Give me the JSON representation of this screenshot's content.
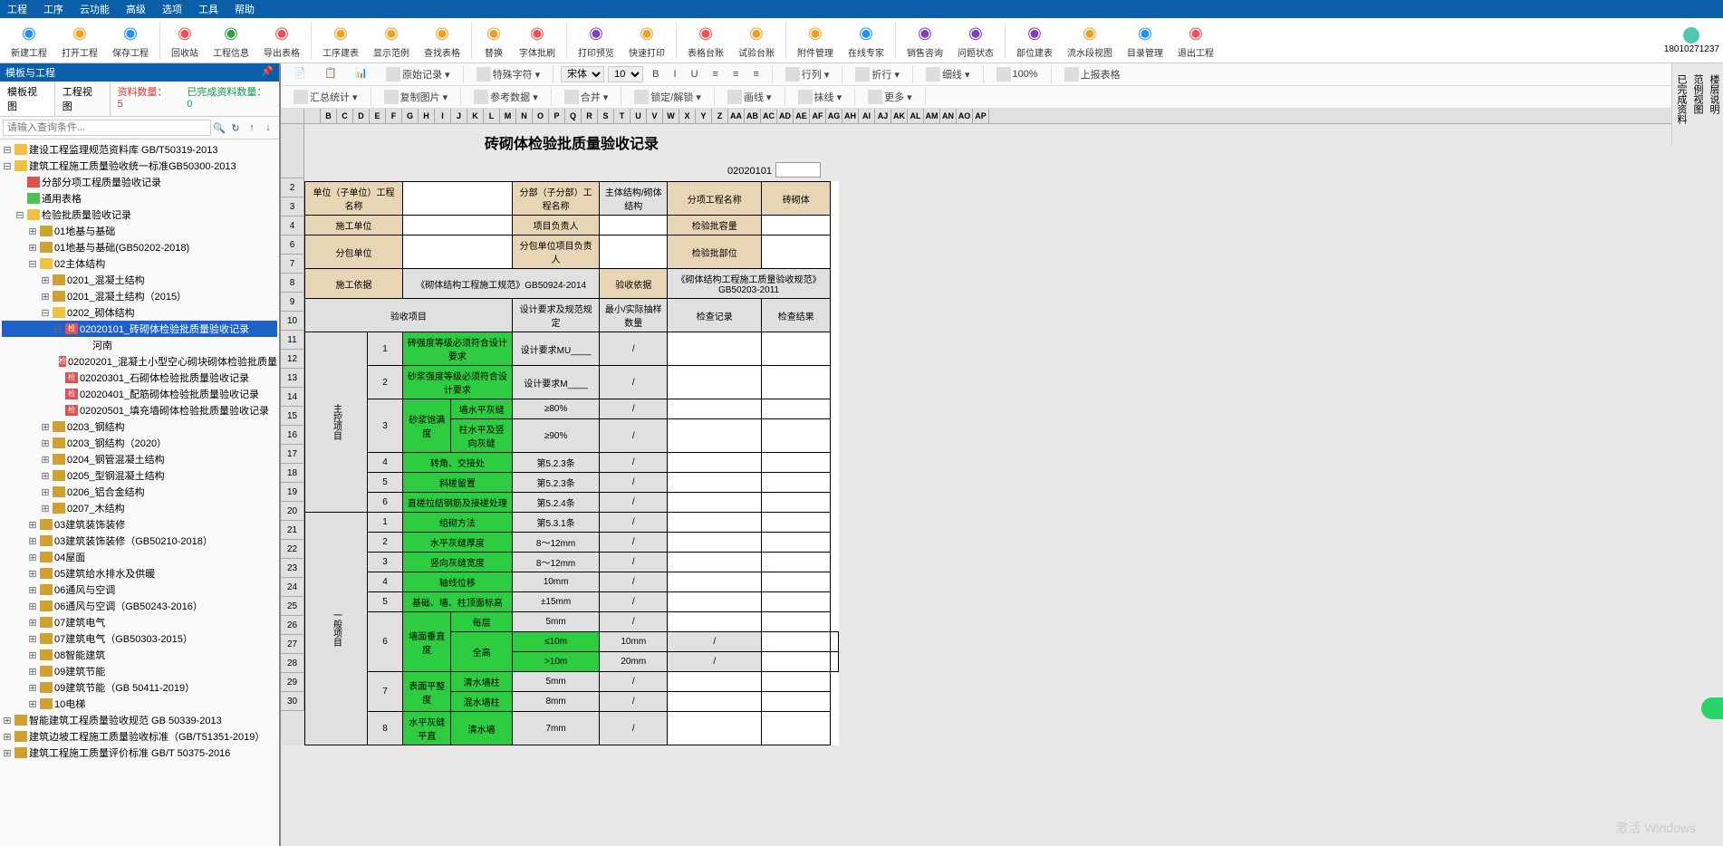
{
  "menu": [
    "工程",
    "工序",
    "云功能",
    "高级",
    "选项",
    "工具",
    "帮助"
  ],
  "toolbar": [
    {
      "label": "新建工程",
      "color": "#1e90ff"
    },
    {
      "label": "打开工程",
      "color": "#f0a020"
    },
    {
      "label": "保存工程",
      "color": "#1e90ff"
    },
    {
      "sep": true
    },
    {
      "label": "回收站",
      "color": "#f05050"
    },
    {
      "label": "工程信息",
      "color": "#2ea044"
    },
    {
      "label": "导出表格",
      "color": "#f05050"
    },
    {
      "sep": true
    },
    {
      "label": "工序建表",
      "color": "#f0a020"
    },
    {
      "label": "显示范例",
      "color": "#f0a020"
    },
    {
      "label": "查找表格",
      "color": "#f0a020"
    },
    {
      "sep": true
    },
    {
      "label": "替换",
      "color": "#f0a020"
    },
    {
      "label": "字体批刷",
      "color": "#f05050"
    },
    {
      "sep": true
    },
    {
      "label": "打印预览",
      "color": "#8040c0"
    },
    {
      "label": "快速打印",
      "color": "#f0a020"
    },
    {
      "sep": true
    },
    {
      "label": "表格台账",
      "color": "#f05050"
    },
    {
      "label": "试验台账",
      "color": "#f0a020"
    },
    {
      "sep": true
    },
    {
      "label": "附件管理",
      "color": "#f0a020"
    },
    {
      "label": "在线专家",
      "color": "#1e90ff"
    },
    {
      "sep": true
    },
    {
      "label": "销售咨询",
      "color": "#8040c0"
    },
    {
      "label": "问题状态",
      "color": "#8040c0"
    },
    {
      "sep": true
    },
    {
      "label": "部位建表",
      "color": "#8040c0"
    },
    {
      "label": "流水段视图",
      "color": "#f0a020"
    },
    {
      "label": "目录管理",
      "color": "#1e90ff"
    },
    {
      "label": "退出工程",
      "color": "#f05050"
    }
  ],
  "user_id": "18010271237",
  "panel_title": "模板与工程",
  "tabs": {
    "t1": "模板视图",
    "t2": "工程视图",
    "count1_label": "资料数量：",
    "count1": "5",
    "count2_label": "已完成资料数量：",
    "count2": "0"
  },
  "search_placeholder": "请输入查询条件...",
  "tree": [
    {
      "d": 0,
      "tog": "-",
      "ico": "y",
      "t": "建设工程监理规范资料库  GB/T50319-2013"
    },
    {
      "d": 0,
      "tog": "-",
      "ico": "y",
      "t": "建筑工程施工质量验收统一标准GB50300-2013"
    },
    {
      "d": 1,
      "tog": "",
      "ico": "r",
      "t": "分部分项工程质量验收记录"
    },
    {
      "d": 1,
      "tog": "",
      "ico": "g",
      "t": "通用表格"
    },
    {
      "d": 1,
      "tog": "-",
      "ico": "y",
      "t": "检验批质量验收记录"
    },
    {
      "d": 2,
      "tog": "+",
      "ico": "c",
      "t": "01地基与基础"
    },
    {
      "d": 2,
      "tog": "+",
      "ico": "c",
      "t": "01地基与基础(GB50202-2018)"
    },
    {
      "d": 2,
      "tog": "-",
      "ico": "y",
      "t": "02主体结构"
    },
    {
      "d": 3,
      "tog": "+",
      "ico": "c",
      "t": "0201_混凝土结构"
    },
    {
      "d": 3,
      "tog": "+",
      "ico": "c",
      "t": "0201_混凝土结构（2015）"
    },
    {
      "d": 3,
      "tog": "-",
      "ico": "y",
      "t": "0202_砌体结构"
    },
    {
      "d": 4,
      "tog": "-",
      "ico": "m",
      "t": "02020101_砖砌体检验批质量验收记录",
      "sel": true
    },
    {
      "d": 5,
      "tog": "",
      "ico": "",
      "t": "河南"
    },
    {
      "d": 4,
      "tog": "",
      "ico": "m",
      "t": "02020201_混凝土小型空心砌块砌体检验批质量"
    },
    {
      "d": 4,
      "tog": "",
      "ico": "m",
      "t": "02020301_石砌体检验批质量验收记录"
    },
    {
      "d": 4,
      "tog": "",
      "ico": "m",
      "t": "02020401_配筋砌体检验批质量验收记录"
    },
    {
      "d": 4,
      "tog": "",
      "ico": "m",
      "t": "02020501_填充墙砌体检验批质量验收记录"
    },
    {
      "d": 3,
      "tog": "+",
      "ico": "c",
      "t": "0203_钢结构"
    },
    {
      "d": 3,
      "tog": "+",
      "ico": "c",
      "t": "0203_钢结构（2020）"
    },
    {
      "d": 3,
      "tog": "+",
      "ico": "c",
      "t": "0204_钢管混凝土结构"
    },
    {
      "d": 3,
      "tog": "+",
      "ico": "c",
      "t": "0205_型钢混凝土结构"
    },
    {
      "d": 3,
      "tog": "+",
      "ico": "c",
      "t": "0206_铝合金结构"
    },
    {
      "d": 3,
      "tog": "+",
      "ico": "c",
      "t": "0207_木结构"
    },
    {
      "d": 2,
      "tog": "+",
      "ico": "c",
      "t": "03建筑装饰装修"
    },
    {
      "d": 2,
      "tog": "+",
      "ico": "c",
      "t": "03建筑装饰装修（GB50210-2018）"
    },
    {
      "d": 2,
      "tog": "+",
      "ico": "c",
      "t": "04屋面"
    },
    {
      "d": 2,
      "tog": "+",
      "ico": "c",
      "t": "05建筑给水排水及供暖"
    },
    {
      "d": 2,
      "tog": "+",
      "ico": "c",
      "t": "06通风与空调"
    },
    {
      "d": 2,
      "tog": "+",
      "ico": "c",
      "t": "06通风与空调（GB50243-2016）"
    },
    {
      "d": 2,
      "tog": "+",
      "ico": "c",
      "t": "07建筑电气"
    },
    {
      "d": 2,
      "tog": "+",
      "ico": "c",
      "t": "07建筑电气（GB50303-2015）"
    },
    {
      "d": 2,
      "tog": "+",
      "ico": "c",
      "t": "08智能建筑"
    },
    {
      "d": 2,
      "tog": "+",
      "ico": "c",
      "t": "09建筑节能"
    },
    {
      "d": 2,
      "tog": "+",
      "ico": "c",
      "t": "09建筑节能（GB 50411-2019）"
    },
    {
      "d": 2,
      "tog": "+",
      "ico": "c",
      "t": "10电梯"
    },
    {
      "d": 0,
      "tog": "+",
      "ico": "c",
      "t": "智能建筑工程质量验收规范  GB 50339-2013"
    },
    {
      "d": 0,
      "tog": "+",
      "ico": "c",
      "t": "建筑边坡工程施工质量验收标准（GB/T51351-2019）"
    },
    {
      "d": 0,
      "tog": "+",
      "ico": "c",
      "t": "建筑工程施工质量评价标准  GB/T 50375-2016"
    }
  ],
  "ribbon2a": [
    {
      "t": "原始记录"
    },
    {
      "t": "特殊字符"
    }
  ],
  "ribbon2b": [
    "宋体",
    "10"
  ],
  "ribbon2c": [
    {
      "t": "行列"
    },
    {
      "t": "折行"
    },
    {
      "t": "细线"
    },
    {
      "t": "100%"
    },
    {
      "t": "上报表格"
    }
  ],
  "ribbon3": [
    {
      "t": "汇总统计"
    },
    {
      "t": "复制图片"
    },
    {
      "t": "参考数据"
    },
    {
      "t": "合并"
    },
    {
      "t": "锁定/解锁"
    },
    {
      "t": "画线"
    },
    {
      "t": "抹线"
    },
    {
      "t": "更多"
    }
  ],
  "cols": [
    "",
    "B",
    "C",
    "D",
    "E",
    "F",
    "G",
    "H",
    "I",
    "J",
    "K",
    "L",
    "M",
    "N",
    "O",
    "P",
    "Q",
    "R",
    "S",
    "T",
    "U",
    "V",
    "W",
    "X",
    "Y",
    "Z",
    "AA",
    "AB",
    "AC",
    "AD",
    "AE",
    "AF",
    "AG",
    "AH",
    "AI",
    "AJ",
    "AK",
    "AL",
    "AM",
    "AN",
    "AO",
    "AP"
  ],
  "rownums": [
    "2",
    "3",
    "4",
    "6",
    "7",
    "8",
    "9",
    "10",
    "11",
    "12",
    "13",
    "14",
    "15",
    "16",
    "17",
    "18",
    "19",
    "20",
    "21",
    "22",
    "23",
    "24",
    "25",
    "26",
    "27",
    "28",
    "29",
    "30"
  ],
  "doc": {
    "title": "砖砌体检验批质量验收记录",
    "code": "02020101",
    "h": {
      "unit": "单位（子单位）工程名称",
      "sub": "分部（子分部）工程名称",
      "mainstruct": "主体结构/砌体结构",
      "itemname": "分项工程名称",
      "brick": "砖砌体",
      "sgdw": "施工单位",
      "xmfzr": "项目负责人",
      "jypr": "检验批容量",
      "fbdw": "分包单位",
      "fbfzr": "分包单位项目负责人",
      "jybw": "检验批部位",
      "sgyj": "施工依据",
      "sgyj_v": "《砌体结构工程施工规范》GB50924-2014",
      "ysyj": "验收依据",
      "ysyj_v": "《砌体结构工程施工质量验收规范》GB50203-2011",
      "ysxm": "验收项目",
      "sjyq": "设计要求及规范规定",
      "cysl": "最小/实际抽样数量",
      "jcjl": "检查记录",
      "jcjg": "检查结果",
      "zkxm": "主控项目",
      "ybxm": "一般项目"
    },
    "rows": [
      {
        "n": "1",
        "a": "砖强度等级必须符合设计要求",
        "b": "设计要求MU____",
        "c": "/",
        "green": true
      },
      {
        "n": "2",
        "a": "砂浆强度等级必须符合设计要求",
        "b": "设计要求M____",
        "c": "/",
        "green": true,
        "tall": true
      },
      {
        "n": "3",
        "a": "砂浆饱满度",
        "a2": "墙水平灰缝",
        "b": "≥80%",
        "c": "/",
        "green": true,
        "span": 2
      },
      {
        "n": "",
        "a": "",
        "a2": "柱水平及竖向灰缝",
        "b": "≥90%",
        "c": "/",
        "green": true
      },
      {
        "n": "4",
        "a": "转角、交接处",
        "b": "第5.2.3条",
        "c": "/",
        "green": true
      },
      {
        "n": "5",
        "a": "斜槎留置",
        "b": "第5.2.3条",
        "c": "/",
        "green": true
      },
      {
        "n": "6",
        "a": "直槎拉结钢筋及接槎处理",
        "b": "第5.2.4条",
        "c": "/",
        "green": true
      }
    ],
    "rows2": [
      {
        "n": "1",
        "a": "组砌方法",
        "b": "第5.3.1条",
        "c": "/",
        "green": true
      },
      {
        "n": "2",
        "a": "水平灰缝厚度",
        "b": "8～12mm",
        "c": "/",
        "green": true
      },
      {
        "n": "3",
        "a": "竖向灰缝宽度",
        "b": "8～12mm",
        "c": "/",
        "green": true
      },
      {
        "n": "4",
        "a": "轴线位移",
        "b": "10mm",
        "c": "/",
        "green": true
      },
      {
        "n": "5",
        "a": "基础、墙、柱顶面标高",
        "b": "±15mm",
        "c": "/",
        "green": true
      },
      {
        "n": "6",
        "a": "墙面垂直度",
        "a2": "每层",
        "b": "5mm",
        "c": "/",
        "green": true,
        "span": 3
      },
      {
        "n": "",
        "a": "",
        "a2": "全高",
        "a3": "≤10m",
        "b": "10mm",
        "c": "/",
        "green": true
      },
      {
        "n": "",
        "a": "",
        "a2": "",
        "a3": ">10m",
        "b": "20mm",
        "c": "/",
        "green": true
      },
      {
        "n": "7",
        "a": "表面平整度",
        "a2": "清水墙柱",
        "b": "5mm",
        "c": "/",
        "green": true,
        "span": 2
      },
      {
        "n": "",
        "a": "",
        "a2": "混水墙柱",
        "b": "8mm",
        "c": "/",
        "green": true
      },
      {
        "n": "8",
        "a": "水平灰缝平直",
        "a2": "清水墙",
        "b": "7mm",
        "c": "/",
        "green": true,
        "span": 2
      }
    ]
  },
  "side_tabs": [
    "楼层说明",
    "范例视图",
    "已完成资料"
  ],
  "watermark": "激活 Windows"
}
